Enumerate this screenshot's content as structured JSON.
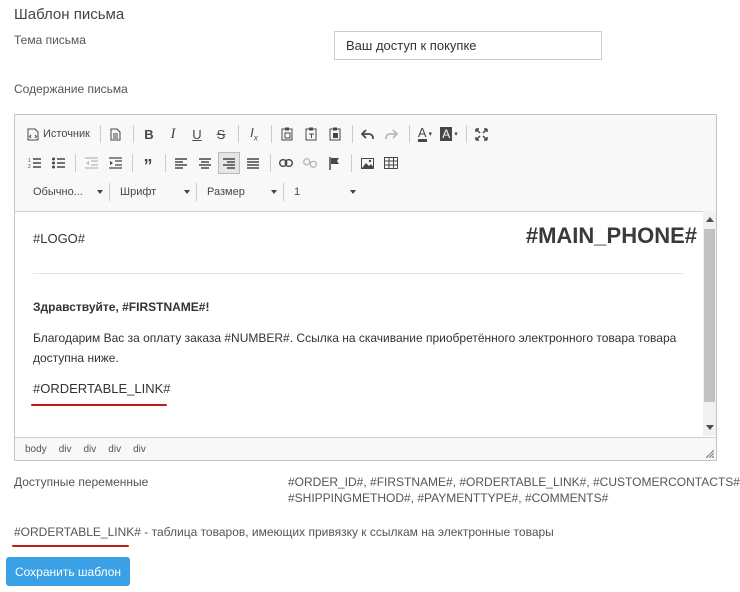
{
  "page": {
    "title": "Шаблон письма",
    "subject_label": "Тема письма",
    "subject_value": "Ваш доступ к покупке",
    "content_label": "Содержание письма"
  },
  "toolbar": {
    "row1": {
      "source_label": "Источник",
      "icons": [
        "source-icon",
        "document-icon",
        "bold-icon",
        "italic-icon",
        "underline-icon",
        "strikethrough-icon",
        "remove-format-icon",
        "paste-icon",
        "paste-text-icon",
        "paste-word-icon",
        "undo-icon",
        "redo-icon",
        "text-color-icon",
        "bg-color-icon",
        "maximize-icon"
      ]
    },
    "row3": {
      "format": "Обычно...",
      "font": "Шрифт",
      "size": "Размер",
      "lineheight": "1"
    }
  },
  "content": {
    "logo": "#LOGO#",
    "phone": "#MAIN_PHONE#",
    "greeting": "Здравствуйте, #FIRSTNAME#!",
    "body": "Благодарим Вас за оплату заказа #NUMBER#. Ссылка на скачивание приобретённого электронного товара товара доступна ниже.",
    "link": "#ORDERTABLE_LINK#"
  },
  "path_items": [
    "body",
    "div",
    "div",
    "div",
    "div"
  ],
  "vars": {
    "label": "Доступные переменные",
    "line1": "#ORDER_ID#, #FIRSTNAME#, #ORDERTABLE_LINK#, #CUSTOMERCONTACTS#, #STC",
    "line2": "#SHIPPINGMETHOD#, #PAYMENTTYPE#, #COMMENTS#"
  },
  "note": {
    "code": "#ORDERTABLE_LINK#",
    "text": " - таблица товаров, имеющих привязку к ссылкам на электронные товары"
  },
  "save_button": "Сохранить шаблон",
  "colors": {
    "accent": "#3aa1e6",
    "underline": "#c01b1b"
  }
}
